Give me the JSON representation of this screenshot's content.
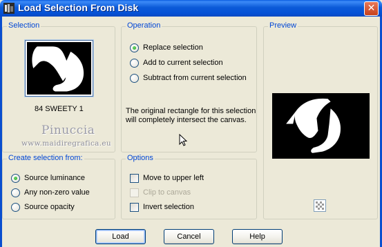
{
  "window": {
    "title": "Load Selection From Disk",
    "icon": "app-icon",
    "close_label": "✕"
  },
  "selection": {
    "label": "Selection",
    "item_name": "84 SWEETY 1",
    "watermark_name": "Pinuccia",
    "watermark_url": "www.maidiregrafica.eu"
  },
  "operation": {
    "label": "Operation",
    "options": [
      "Replace selection",
      "Add to current selection",
      "Subtract from current selection"
    ],
    "selected": "Replace selection",
    "info": "The original rectangle for this selection will completely intersect the canvas."
  },
  "preview": {
    "label": "Preview",
    "toggle_icon": "checkerboard-icon"
  },
  "create_from": {
    "label": "Create selection from:",
    "options": [
      "Source luminance",
      "Any non-zero value",
      "Source opacity"
    ],
    "selected": "Source luminance"
  },
  "options": {
    "label": "Options",
    "move_upper_left": "Move to upper left",
    "clip_to_canvas": "Clip to canvas",
    "invert_selection": "Invert selection",
    "move_upper_left_checked": false,
    "clip_to_canvas_checked": false,
    "clip_to_canvas_enabled": false,
    "invert_selection_checked": false
  },
  "buttons": {
    "load": "Load",
    "cancel": "Cancel",
    "help": "Help"
  },
  "colors": {
    "title_bar": "#0551d6",
    "group_label": "#0046d5",
    "dialog_bg": "#ece9d8"
  }
}
